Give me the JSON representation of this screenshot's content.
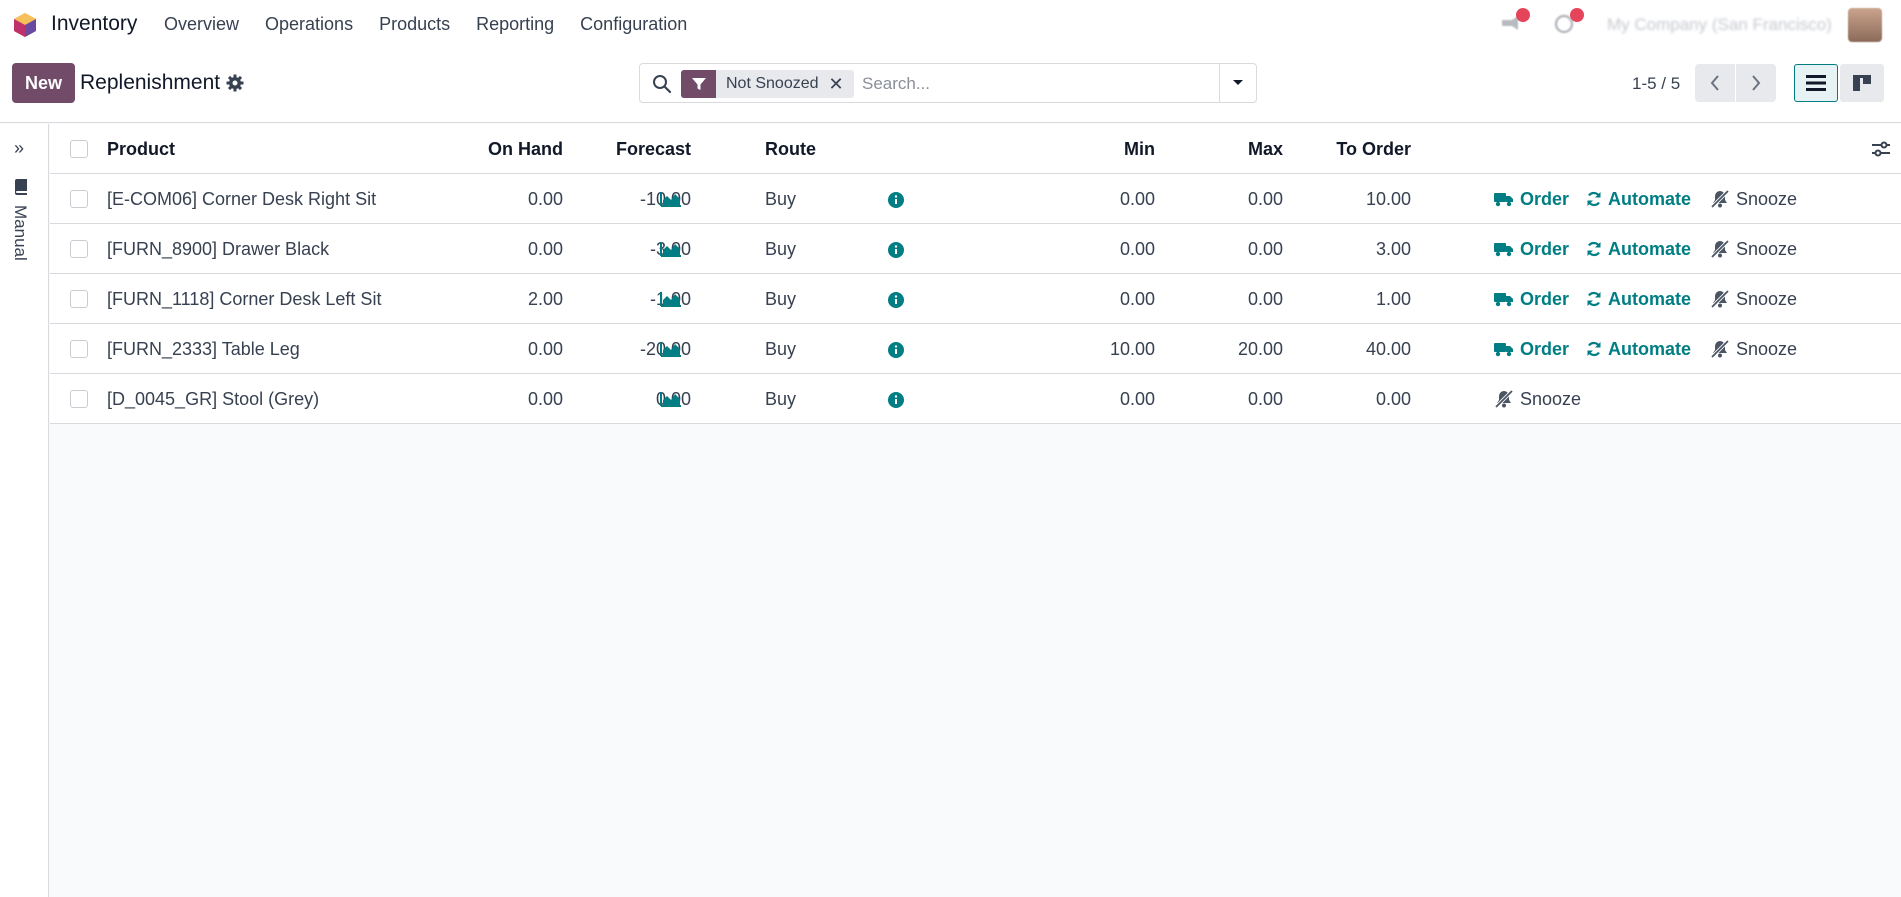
{
  "app": {
    "name": "Inventory"
  },
  "menu": [
    "Overview",
    "Operations",
    "Products",
    "Reporting",
    "Configuration"
  ],
  "user": {
    "company": "My Company (San Francisco)"
  },
  "control": {
    "new_label": "New",
    "title": "Replenishment",
    "facet": "Not Snoozed",
    "facet_remove": "✕",
    "search_placeholder": "Search...",
    "pager": "1-5 / 5"
  },
  "side": {
    "label": "Manual",
    "toggle": "»"
  },
  "table": {
    "headers": {
      "product": "Product",
      "on_hand": "On Hand",
      "forecast": "Forecast",
      "route": "Route",
      "min": "Min",
      "max": "Max",
      "to_order": "To Order"
    },
    "actions": {
      "order": "Order",
      "automate": "Automate",
      "snooze": "Snooze"
    },
    "rows": [
      {
        "product": "[E-COM06] Corner Desk Right Sit",
        "on_hand": "0.00",
        "forecast": "-10.00",
        "route": "Buy",
        "min": "0.00",
        "max": "0.00",
        "to_order": "10.00"
      },
      {
        "product": "[FURN_8900] Drawer Black",
        "on_hand": "0.00",
        "forecast": "-3.00",
        "route": "Buy",
        "min": "0.00",
        "max": "0.00",
        "to_order": "3.00"
      },
      {
        "product": "[FURN_1118] Corner Desk Left Sit",
        "on_hand": "2.00",
        "forecast": "-1.00",
        "route": "Buy",
        "min": "0.00",
        "max": "0.00",
        "to_order": "1.00"
      },
      {
        "product": "[FURN_2333] Table Leg",
        "on_hand": "0.00",
        "forecast": "-20.00",
        "route": "Buy",
        "min": "10.00",
        "max": "20.00",
        "to_order": "40.00"
      },
      {
        "product": "[D_0045_GR] Stool (Grey)",
        "on_hand": "0.00",
        "forecast": "0.00",
        "route": "Buy",
        "min": "0.00",
        "max": "0.00",
        "to_order": "0.00"
      }
    ]
  },
  "colors": {
    "brand": "#714b67",
    "accent": "#017e84",
    "badge": "#e5455a"
  }
}
